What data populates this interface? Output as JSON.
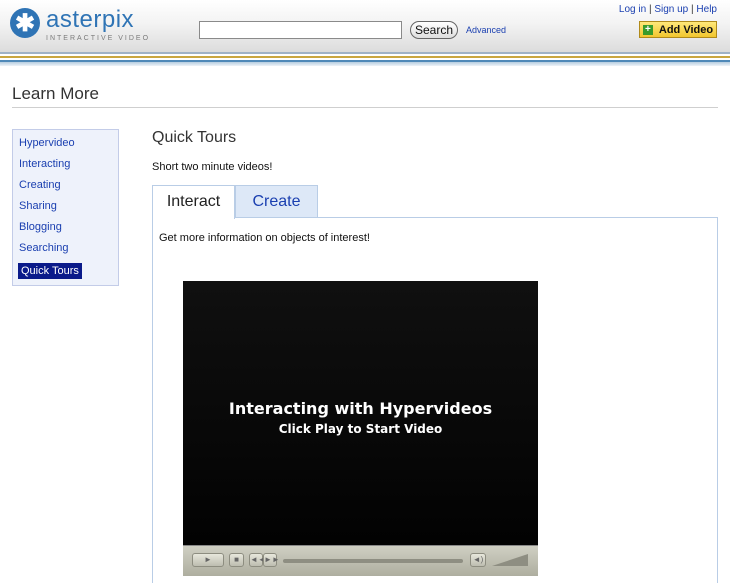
{
  "brand": {
    "name": "asterpix",
    "tagline": "INTERACTIVE VIDEO",
    "mark": "✱",
    "color": "#2f74b5"
  },
  "header": {
    "search_placeholder": "",
    "search_label": "Search",
    "advanced_label": "Advanced",
    "login_label": "Log in",
    "signup_label": "Sign up",
    "help_label": "Help",
    "separator": "|",
    "add_video_label": "Add Video",
    "add_icon": "+"
  },
  "page": {
    "title": "Learn More"
  },
  "sidebar": {
    "items": [
      {
        "label": "Hypervideo"
      },
      {
        "label": "Interacting"
      },
      {
        "label": "Creating"
      },
      {
        "label": "Sharing"
      },
      {
        "label": "Blogging"
      },
      {
        "label": "Searching"
      },
      {
        "label": "Quick Tours",
        "active": true
      }
    ]
  },
  "main": {
    "title": "Quick Tours",
    "subtitle": "Short two minute videos!",
    "tabs": [
      {
        "label": "Interact",
        "active": true
      },
      {
        "label": "Create",
        "active": false
      }
    ],
    "panel_description": "Get more information on objects of interest!"
  },
  "player": {
    "title": "Interacting with Hypervideos",
    "subtitle": "Click Play to Start Video",
    "play_icon": "►",
    "stop_icon": "■",
    "prev_icon": "◄◄",
    "next_icon": "►►",
    "mute_icon": "◄)"
  }
}
